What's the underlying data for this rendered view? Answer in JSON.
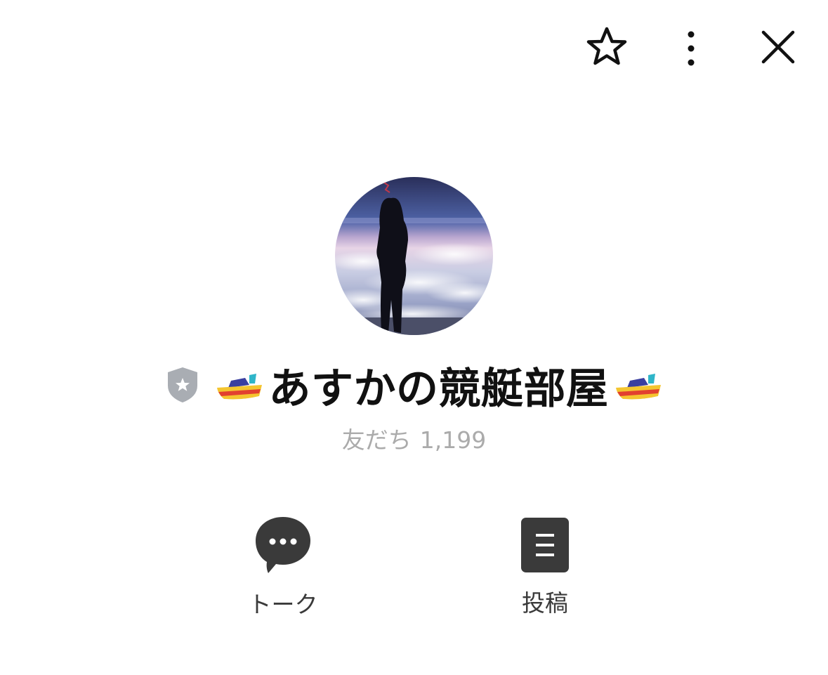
{
  "header": {
    "favorite_icon": "star-outline-icon",
    "more_icon": "vertical-ellipsis-icon",
    "close_icon": "close-x-icon"
  },
  "profile": {
    "name": "あすかの競艇部屋",
    "name_prefix_emoji": "speedboat-emoji",
    "name_suffix_emoji": "speedboat-emoji",
    "badge_icon": "gray-shield-star-icon",
    "friends_label": "友だち",
    "friends_count": "1,199",
    "avatar": "silhouette-over-clouds"
  },
  "actions": [
    {
      "label": "トーク",
      "icon": "chat-bubble-icon"
    },
    {
      "label": "投稿",
      "icon": "posts-list-icon"
    }
  ],
  "colors": {
    "icon_dark": "#3a3a3a",
    "muted_text": "#ababab",
    "badge_gray": "#a9adb3"
  }
}
